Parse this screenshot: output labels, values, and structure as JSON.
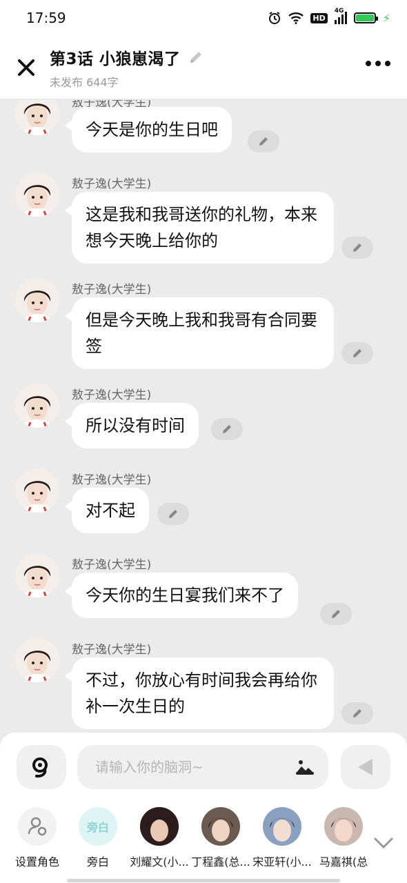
{
  "status_bar": {
    "time": "17:59",
    "hd": "HD",
    "network": "4G"
  },
  "header": {
    "title": "第3话 小狼崽渴了",
    "subtitle": "未发布 644字"
  },
  "messages": [
    {
      "sender": "敖子逸(大学生)",
      "text": "今天是你的生日吧"
    },
    {
      "sender": "敖子逸(大学生)",
      "text": "这是我和我哥送你的礼物，本来想今天晚上给你的"
    },
    {
      "sender": "敖子逸(大学生)",
      "text": "但是今天晚上我和我哥有合同要签"
    },
    {
      "sender": "敖子逸(大学生)",
      "text": "所以没有时间"
    },
    {
      "sender": "敖子逸(大学生)",
      "text": "对不起"
    },
    {
      "sender": "敖子逸(大学生)",
      "text": "今天你的生日宴我们来不了"
    },
    {
      "sender": "敖子逸(大学生)",
      "text": "不过，你放心有时间我会再给你补一次生日的"
    }
  ],
  "input": {
    "placeholder": "请输入你的脑洞~"
  },
  "roles": [
    {
      "label": "设置角色"
    },
    {
      "label": "旁白",
      "badge": "旁白"
    },
    {
      "label": "刘耀文(小..."
    },
    {
      "label": "丁程鑫(总..."
    },
    {
      "label": "宋亚轩(小..."
    },
    {
      "label": "马嘉祺(总"
    }
  ],
  "colors": {
    "background": "#ebebeb",
    "bubble": "#ffffff",
    "battery": "#34c759",
    "narrator_bg": "#dff5f5",
    "narrator_text": "#8fd3d3"
  },
  "icons": {
    "close": "close-icon",
    "more": "more-icon",
    "edit": "pencil-icon",
    "voice": "voice-icon",
    "image": "image-icon",
    "send": "send-icon",
    "expand": "chevron-down-icon"
  }
}
